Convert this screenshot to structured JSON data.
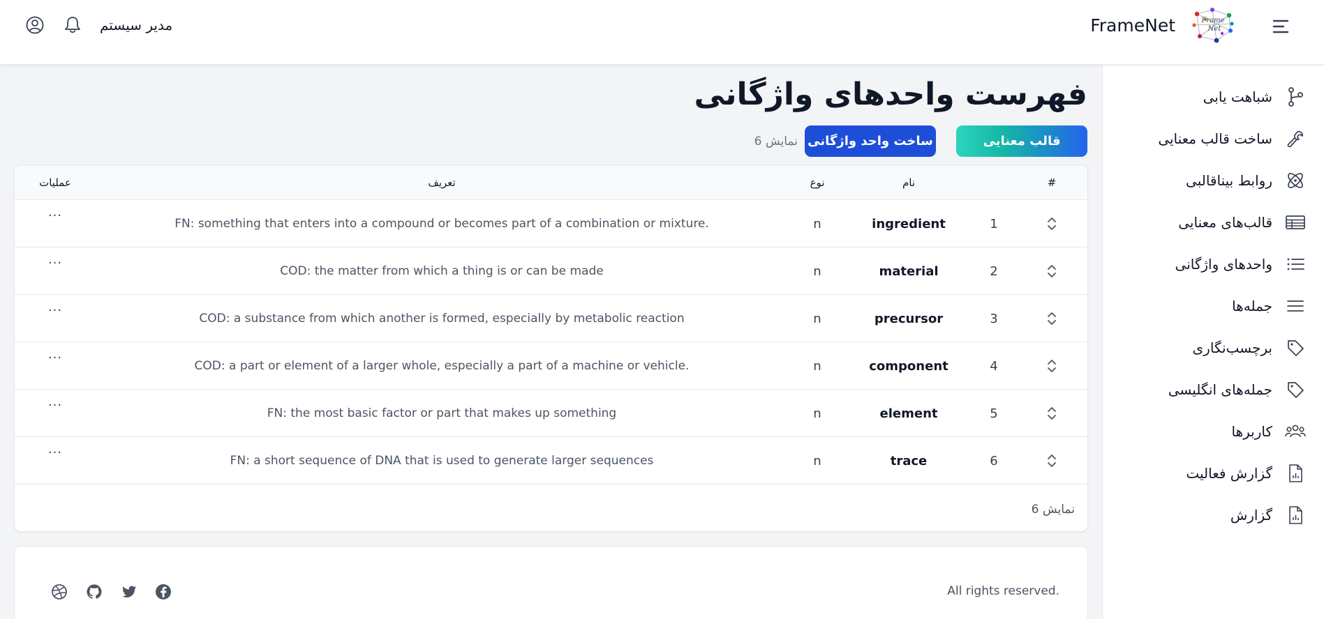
{
  "header": {
    "brand": "FrameNet",
    "logo_text": "FrameNet",
    "user_name": "مدیر سیستم"
  },
  "sidebar": {
    "items": [
      {
        "label": "شباهت یابی",
        "icon": "similarity-icon"
      },
      {
        "label": "ساخت قالب معنایی",
        "icon": "wrench-icon"
      },
      {
        "label": "روابط بیناقالبی",
        "icon": "atom-icon"
      },
      {
        "label": "قالب‌های معنایی",
        "icon": "table-icon"
      },
      {
        "label": "واحدهای واژگانی",
        "icon": "list-icon"
      },
      {
        "label": "جمله‌ها",
        "icon": "lines-icon"
      },
      {
        "label": "برچسب‌نگاری",
        "icon": "tag-icon"
      },
      {
        "label": "جمله‌های انگلیسی",
        "icon": "tag-icon"
      },
      {
        "label": "کاربرها",
        "icon": "users-icon"
      },
      {
        "label": "گزارش فعالیت",
        "icon": "report-icon"
      },
      {
        "label": "گزارش",
        "icon": "report-icon"
      }
    ]
  },
  "main": {
    "title": "فهرست واحدهای واژگانی",
    "frame_button": "قالب معنایی",
    "create_button": "ساخت واحد واژگانی",
    "count_label": "نمایش 6"
  },
  "table": {
    "headers": {
      "index": "#",
      "name": "نام",
      "type": "نوع",
      "definition": "تعریف",
      "ops": "عملیات"
    },
    "rows": [
      {
        "index": "1",
        "name": "ingredient",
        "type": "n",
        "definition": ".FN: something that enters into a compound or becomes part of a combination or mixture",
        "ops": "···"
      },
      {
        "index": "2",
        "name": "material",
        "type": "n",
        "definition": "COD: the matter from which a thing is or can be made",
        "ops": "···"
      },
      {
        "index": "3",
        "name": "precursor",
        "type": "n",
        "definition": "COD: a substance from which another is formed, especially by metabolic reaction",
        "ops": "···"
      },
      {
        "index": "4",
        "name": "component",
        "type": "n",
        "definition": ".COD: a part or element of a larger whole, especially a part of a machine or vehicle",
        "ops": "···"
      },
      {
        "index": "5",
        "name": "element",
        "type": "n",
        "definition": "FN: the most basic factor or part that makes up something",
        "ops": "···"
      },
      {
        "index": "6",
        "name": "trace",
        "type": "n",
        "definition": "FN: a short sequence of DNA that is used to generate larger sequences",
        "ops": "···"
      }
    ],
    "footer_count": "نمایش 6"
  },
  "footer": {
    "rights": ".All rights reserved",
    "social": [
      "facebook-icon",
      "twitter-icon",
      "github-icon",
      "dribbble-icon"
    ]
  },
  "colors": {
    "primary": "#1d4ed8",
    "teal": "#14b8a6",
    "background": "#f3f4f6"
  }
}
